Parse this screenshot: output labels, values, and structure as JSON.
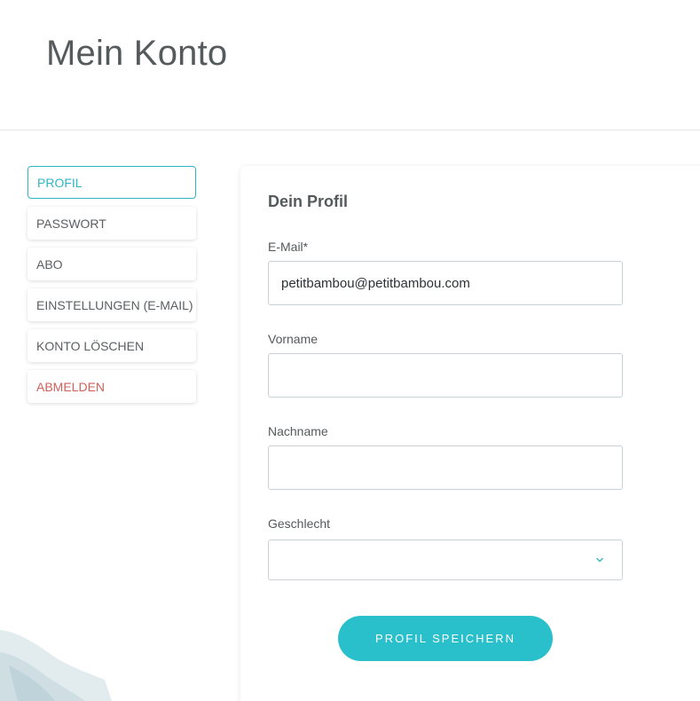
{
  "header": {
    "title": "Mein Konto"
  },
  "sidebar": {
    "items": [
      {
        "label": "PROFIL"
      },
      {
        "label": "PASSWORT"
      },
      {
        "label": "ABO"
      },
      {
        "label": "EINSTELLUNGEN (E-MAIL)"
      },
      {
        "label": "KONTO LÖSCHEN"
      },
      {
        "label": "ABMELDEN"
      }
    ],
    "active_index": 0
  },
  "profile": {
    "title": "Dein Profil",
    "email": {
      "label": "E-Mail*",
      "value": "petitbambou@petitbambou.com"
    },
    "first_name": {
      "label": "Vorname",
      "value": ""
    },
    "last_name": {
      "label": "Nachname",
      "value": ""
    },
    "gender": {
      "label": "Geschlecht",
      "value": ""
    },
    "save_label": "PROFIL SPEICHERN"
  },
  "colors": {
    "accent": "#29bfcb",
    "danger": "#d0605a",
    "text": "#555a5c"
  },
  "icons": {
    "select_arrow": "chevron-down-icon"
  }
}
